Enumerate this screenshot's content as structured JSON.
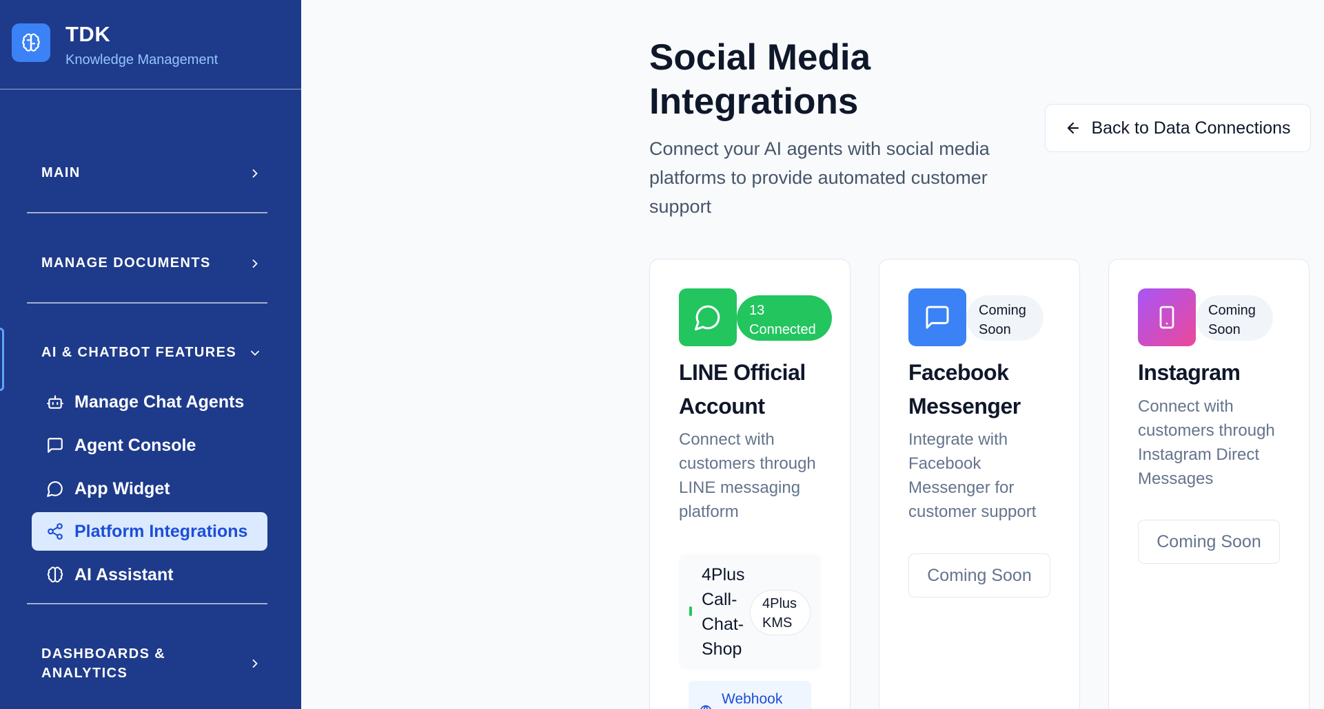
{
  "brand": {
    "name": "TDK",
    "subtitle": "Knowledge Management"
  },
  "sidebar": {
    "sections": [
      {
        "label": "MAIN"
      },
      {
        "label": "MANAGE DOCUMENTS"
      },
      {
        "label": "AI & CHATBOT FEATURES"
      },
      {
        "label": "DASHBOARDS &\nANALYTICS"
      }
    ],
    "items": [
      {
        "label": "Manage Chat Agents",
        "icon": "bot-icon"
      },
      {
        "label": "Agent Console",
        "icon": "message-square-icon"
      },
      {
        "label": "App Widget",
        "icon": "message-circle-icon"
      },
      {
        "label": "Platform Integrations",
        "icon": "share-icon",
        "active": true
      },
      {
        "label": "AI Assistant",
        "icon": "brain-icon"
      }
    ]
  },
  "header": {
    "title": "Social Media Integrations",
    "subtitle": "Connect your AI agents with social media platforms to provide automated customer support",
    "back_label": "Back to Data Connections"
  },
  "cards": [
    {
      "title": "LINE Official Account",
      "badge": "13 Connected",
      "description": "Connect with customers through LINE messaging platform",
      "icon": "message-circle-icon",
      "color": "#22c55e",
      "connection": {
        "name": "4Plus Call-Chat-Shop",
        "pill": "4Plus KMS",
        "webhook": "Webhook"
      }
    },
    {
      "title": "Facebook Messenger",
      "badge": "Coming Soon",
      "description": "Integrate with Facebook Messenger for customer support",
      "icon": "message-square-icon",
      "color": "#3b82f6",
      "button": "Coming Soon"
    },
    {
      "title": "Instagram",
      "badge": "Coming Soon",
      "description": "Connect with customers through Instagram Direct Messages",
      "icon": "smartphone-icon",
      "color": "#c026d3",
      "button": "Coming Soon"
    }
  ],
  "colors": {
    "sidebar": "#1e3a8a",
    "accent": "#3b82f6",
    "success": "#22c55e",
    "instagram_from": "#a855f7",
    "instagram_to": "#ec4899"
  }
}
